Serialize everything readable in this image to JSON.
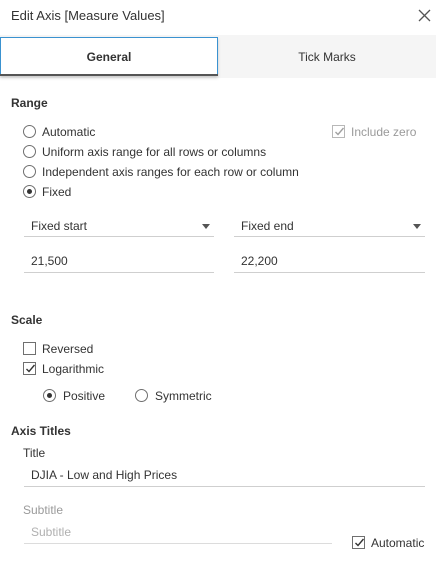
{
  "dialog": {
    "title": "Edit Axis [Measure Values]"
  },
  "tabs": [
    {
      "label": "General"
    },
    {
      "label": "Tick Marks"
    }
  ],
  "range": {
    "section_title": "Range",
    "options": [
      {
        "label": "Automatic",
        "selected": false
      },
      {
        "label": "Uniform axis range for all rows or columns",
        "selected": false
      },
      {
        "label": "Independent axis ranges for each row or column",
        "selected": false
      },
      {
        "label": "Fixed",
        "selected": true
      }
    ],
    "include_zero": {
      "label": "Include zero",
      "checked": true,
      "disabled": true
    },
    "start_dropdown": "Fixed start",
    "end_dropdown": "Fixed end",
    "start_value": "21,500",
    "end_value": "22,200"
  },
  "scale": {
    "section_title": "Scale",
    "reversed": {
      "label": "Reversed",
      "checked": false
    },
    "logarithmic": {
      "label": "Logarithmic",
      "checked": true
    },
    "positive": {
      "label": "Positive",
      "selected": true
    },
    "symmetric": {
      "label": "Symmetric",
      "selected": false
    }
  },
  "axis_titles": {
    "section_title": "Axis Titles",
    "title_label": "Title",
    "title_value": "DJIA - Low and High Prices",
    "subtitle_label": "Subtitle",
    "subtitle_placeholder": "Subtitle",
    "automatic": {
      "label": "Automatic",
      "checked": true
    }
  },
  "colors": {
    "accent": "#3a92d0",
    "text": "#333333",
    "muted": "#9a9a9a"
  }
}
